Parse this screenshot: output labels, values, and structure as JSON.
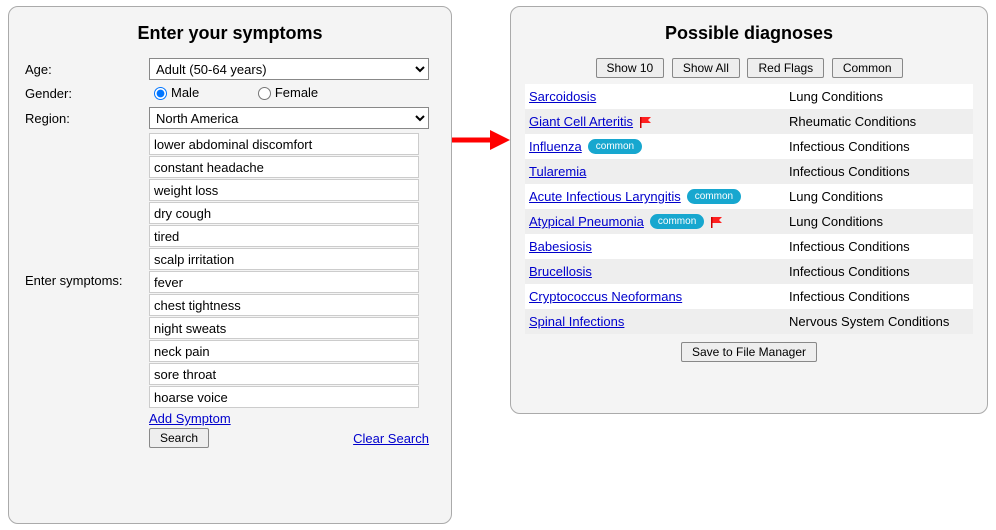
{
  "left": {
    "title": "Enter your symptoms",
    "age_label": "Age:",
    "age_value": "Adult (50-64 years)",
    "gender_label": "Gender:",
    "gender_male": "Male",
    "gender_female": "Female",
    "region_label": "Region:",
    "region_value": "North America",
    "symptoms_label": "Enter symptoms:",
    "symptoms": [
      "lower abdominal discomfort",
      "constant headache",
      "weight loss",
      "dry cough",
      "tired",
      "scalp irritation",
      "fever",
      "chest tightness",
      "night sweats",
      "neck pain",
      "sore throat",
      "hoarse voice"
    ],
    "add_symptom": "Add Symptom",
    "search": "Search",
    "clear": "Clear Search"
  },
  "right": {
    "title": "Possible diagnoses",
    "filters": {
      "show10": "Show 10",
      "showall": "Show All",
      "redflags": "Red Flags",
      "common": "Common"
    },
    "common_badge": "common",
    "diagnoses": [
      {
        "name": "Sarcoidosis",
        "category": "Lung Conditions",
        "flag": false,
        "common": false
      },
      {
        "name": "Giant Cell Arteritis",
        "category": "Rheumatic Conditions",
        "flag": true,
        "common": false
      },
      {
        "name": "Influenza",
        "category": "Infectious Conditions",
        "flag": false,
        "common": true
      },
      {
        "name": "Tularemia",
        "category": "Infectious Conditions",
        "flag": false,
        "common": false
      },
      {
        "name": "Acute Infectious Laryngitis",
        "category": "Lung Conditions",
        "flag": false,
        "common": true
      },
      {
        "name": "Atypical Pneumonia",
        "category": "Lung Conditions",
        "flag": true,
        "common": true
      },
      {
        "name": "Babesiosis",
        "category": "Infectious Conditions",
        "flag": false,
        "common": false
      },
      {
        "name": "Brucellosis",
        "category": "Infectious Conditions",
        "flag": false,
        "common": false
      },
      {
        "name": "Cryptococcus Neoformans",
        "category": "Infectious Conditions",
        "flag": false,
        "common": false
      },
      {
        "name": "Spinal Infections",
        "category": "Nervous System Conditions",
        "flag": false,
        "common": false
      }
    ],
    "save": "Save to File Manager"
  }
}
